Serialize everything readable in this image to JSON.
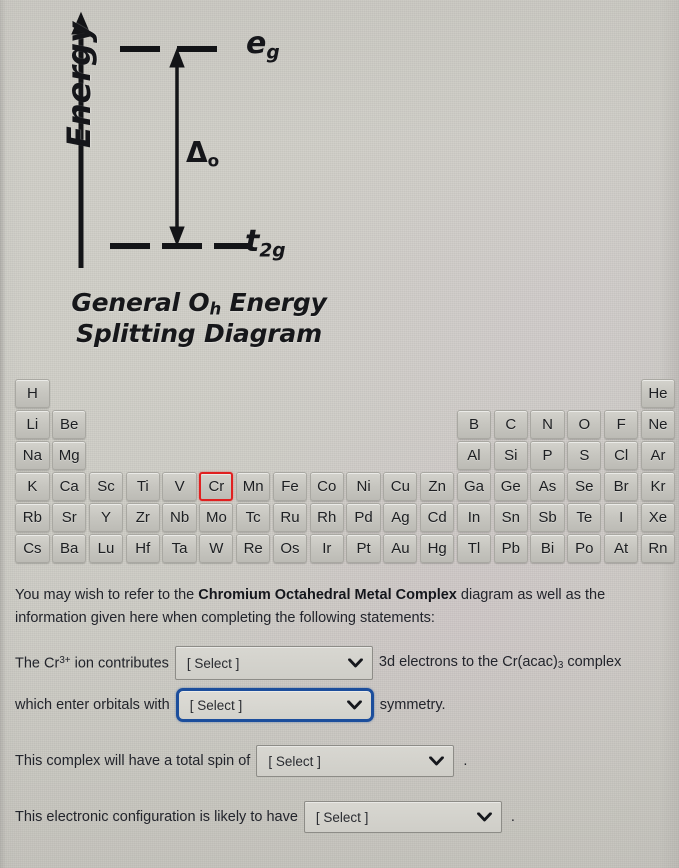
{
  "diagram": {
    "axis_label": "Energy",
    "eg_label": "e",
    "eg_sub": "g",
    "t2g_label": "t",
    "t2g_sub": "2g",
    "delta_label": "Δ",
    "delta_sub": "o",
    "caption_line1_a": "General O",
    "caption_line1_sub": "h",
    "caption_line1_b": " Energy",
    "caption_line2": "Splitting Diagram",
    "eg_orbital_count": 2,
    "t2g_orbital_count": 3
  },
  "periodic_table": {
    "selected_element": "Cr",
    "selected_highlight_color": "#e02020",
    "rows": [
      [
        {
          "symbol": "H",
          "col": 1
        },
        {
          "symbol": "He",
          "col": 18
        }
      ],
      [
        {
          "symbol": "Li",
          "col": 1
        },
        {
          "symbol": "Be",
          "col": 2
        },
        {
          "symbol": "B",
          "col": 13
        },
        {
          "symbol": "C",
          "col": 14
        },
        {
          "symbol": "N",
          "col": 15
        },
        {
          "symbol": "O",
          "col": 16
        },
        {
          "symbol": "F",
          "col": 17
        },
        {
          "symbol": "Ne",
          "col": 18
        }
      ],
      [
        {
          "symbol": "Na",
          "col": 1
        },
        {
          "symbol": "Mg",
          "col": 2
        },
        {
          "symbol": "Al",
          "col": 13
        },
        {
          "symbol": "Si",
          "col": 14
        },
        {
          "symbol": "P",
          "col": 15
        },
        {
          "symbol": "S",
          "col": 16
        },
        {
          "symbol": "Cl",
          "col": 17
        },
        {
          "symbol": "Ar",
          "col": 18
        }
      ],
      [
        {
          "symbol": "K",
          "col": 1
        },
        {
          "symbol": "Ca",
          "col": 2
        },
        {
          "symbol": "Sc",
          "col": 3
        },
        {
          "symbol": "Ti",
          "col": 4
        },
        {
          "symbol": "V",
          "col": 5
        },
        {
          "symbol": "Cr",
          "col": 6,
          "selected": true
        },
        {
          "symbol": "Mn",
          "col": 7
        },
        {
          "symbol": "Fe",
          "col": 8
        },
        {
          "symbol": "Co",
          "col": 9
        },
        {
          "symbol": "Ni",
          "col": 10
        },
        {
          "symbol": "Cu",
          "col": 11
        },
        {
          "symbol": "Zn",
          "col": 12
        },
        {
          "symbol": "Ga",
          "col": 13
        },
        {
          "symbol": "Ge",
          "col": 14
        },
        {
          "symbol": "As",
          "col": 15
        },
        {
          "symbol": "Se",
          "col": 16
        },
        {
          "symbol": "Br",
          "col": 17
        },
        {
          "symbol": "Kr",
          "col": 18
        }
      ],
      [
        {
          "symbol": "Rb",
          "col": 1
        },
        {
          "symbol": "Sr",
          "col": 2
        },
        {
          "symbol": "Y",
          "col": 3
        },
        {
          "symbol": "Zr",
          "col": 4
        },
        {
          "symbol": "Nb",
          "col": 5
        },
        {
          "symbol": "Mo",
          "col": 6
        },
        {
          "symbol": "Tc",
          "col": 7
        },
        {
          "symbol": "Ru",
          "col": 8
        },
        {
          "symbol": "Rh",
          "col": 9
        },
        {
          "symbol": "Pd",
          "col": 10
        },
        {
          "symbol": "Ag",
          "col": 11
        },
        {
          "symbol": "Cd",
          "col": 12
        },
        {
          "symbol": "In",
          "col": 13
        },
        {
          "symbol": "Sn",
          "col": 14
        },
        {
          "symbol": "Sb",
          "col": 15
        },
        {
          "symbol": "Te",
          "col": 16
        },
        {
          "symbol": "I",
          "col": 17
        },
        {
          "symbol": "Xe",
          "col": 18
        }
      ],
      [
        {
          "symbol": "Cs",
          "col": 1
        },
        {
          "symbol": "Ba",
          "col": 2
        },
        {
          "symbol": "Lu",
          "col": 3
        },
        {
          "symbol": "Hf",
          "col": 4
        },
        {
          "symbol": "Ta",
          "col": 5
        },
        {
          "symbol": "W",
          "col": 6
        },
        {
          "symbol": "Re",
          "col": 7
        },
        {
          "symbol": "Os",
          "col": 8
        },
        {
          "symbol": "Ir",
          "col": 9
        },
        {
          "symbol": "Pt",
          "col": 10
        },
        {
          "symbol": "Au",
          "col": 11
        },
        {
          "symbol": "Hg",
          "col": 12
        },
        {
          "symbol": "Tl",
          "col": 13
        },
        {
          "symbol": "Pb",
          "col": 14
        },
        {
          "symbol": "Bi",
          "col": 15
        },
        {
          "symbol": "Po",
          "col": 16
        },
        {
          "symbol": "At",
          "col": 17
        },
        {
          "symbol": "Rn",
          "col": 18
        }
      ]
    ]
  },
  "intro": {
    "before_bold": "You may wish to refer to the ",
    "bold": "Chromium Octahedral Metal Complex",
    "after_bold": " diagram as well as the information given here when completing the following statements:"
  },
  "questions": [
    {
      "name": "electron-count",
      "prefix_a": "The Cr",
      "prefix_sup": "3+",
      "prefix_b": " ion contributes",
      "select_value": "[ Select ]",
      "suffix_a": "3d electrons to the Cr(acac)",
      "suffix_sub": "3",
      "suffix_b": " complex",
      "focused": false,
      "trailing_period": false
    },
    {
      "name": "orbital-symmetry",
      "prefix_a": "which enter orbitals with",
      "prefix_sup": "",
      "prefix_b": "",
      "select_value": "[ Select ]",
      "suffix_a": "symmetry.",
      "suffix_sub": "",
      "suffix_b": "",
      "focused": true,
      "trailing_period": false
    },
    {
      "name": "total-spin",
      "prefix_a": "This complex will have a total spin of",
      "prefix_sup": "",
      "prefix_b": "",
      "select_value": "[ Select ]",
      "suffix_a": "",
      "suffix_sub": "",
      "suffix_b": "",
      "focused": false,
      "trailing_period": true
    },
    {
      "name": "electronic-configuration",
      "prefix_a": "This electronic configuration is likely to have",
      "prefix_sup": "",
      "prefix_b": "",
      "select_value": "[ Select ]",
      "suffix_a": "",
      "suffix_sub": "",
      "suffix_b": "",
      "focused": false,
      "trailing_period": true
    }
  ]
}
